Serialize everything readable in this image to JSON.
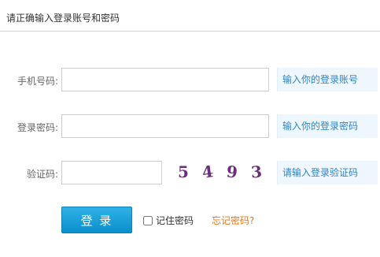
{
  "header": {
    "title": "请正确输入登录账号和密码"
  },
  "form": {
    "phone": {
      "label": "手机号码:",
      "value": "",
      "hint": "输入你的登录账号"
    },
    "password": {
      "label": "登录密码:",
      "value": "",
      "hint": "输入你的登录密码"
    },
    "captcha": {
      "label": "验证码:",
      "value": "",
      "digits": [
        "5",
        "4",
        "9",
        "3"
      ],
      "hint": "请输入登录验证码"
    }
  },
  "actions": {
    "login_label": "登 录",
    "remember_label": "记住密码",
    "remember_checked": false,
    "forgot_label": "忘记密码?"
  },
  "colors": {
    "accent": "#2f86c8",
    "button": "#098fcc",
    "hint_bg": "#eef7fd",
    "forgot": "#e67a16",
    "captcha": "#6b2f7a"
  }
}
